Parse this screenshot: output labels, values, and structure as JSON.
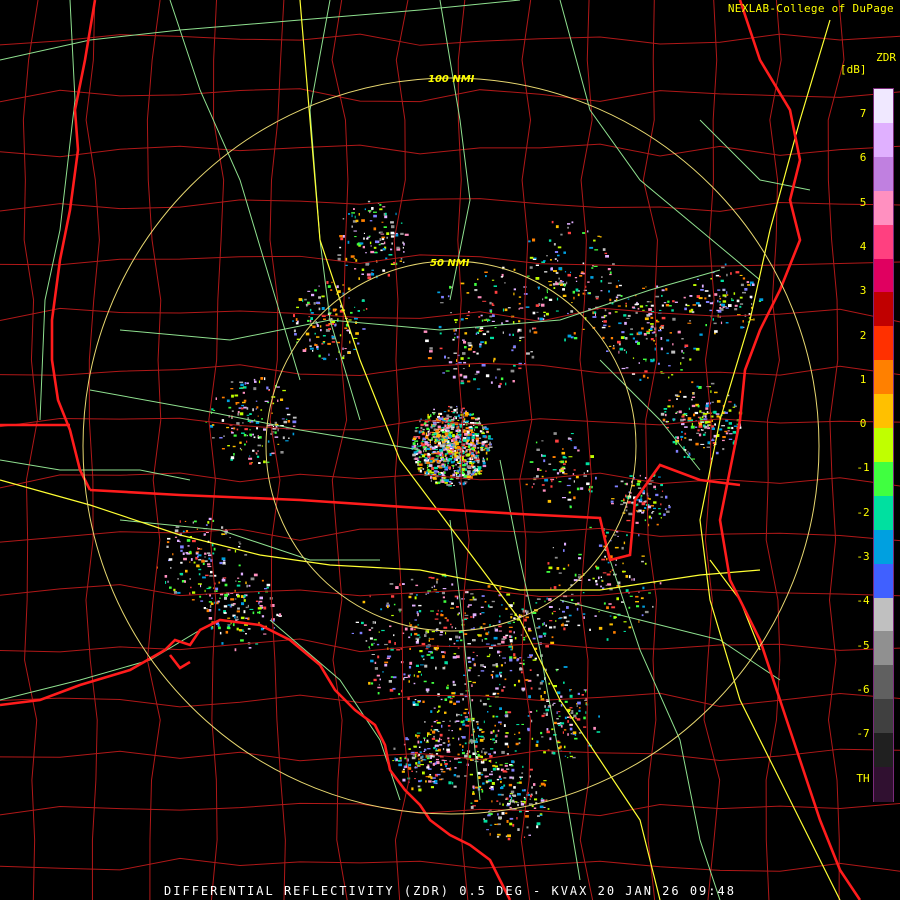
{
  "header": {
    "credit": "NEXLAB-College of DuPage"
  },
  "legend": {
    "title": "ZDR",
    "unit": "[dB]",
    "ticks": [
      "7",
      "6",
      "5",
      "4",
      "3",
      "2",
      "1",
      "0",
      "-1",
      "-2",
      "-3",
      "-4",
      "-5",
      "-6",
      "-7",
      "TH"
    ]
  },
  "rings": {
    "inner_label": "50 NMI",
    "outer_label": "100 NMI"
  },
  "footer": {
    "caption": "DIFFERENTIAL REFLECTIVITY (ZDR) 0.5 DEG - KVAX 20 JAN 26 09:48"
  },
  "colors": {
    "background": "#000000",
    "state_border": "#ff2020",
    "county_border": "#b01818",
    "highway": "#ffff00",
    "road": "#90e090",
    "ring": "#e8d870",
    "text": "#ffff00"
  }
}
